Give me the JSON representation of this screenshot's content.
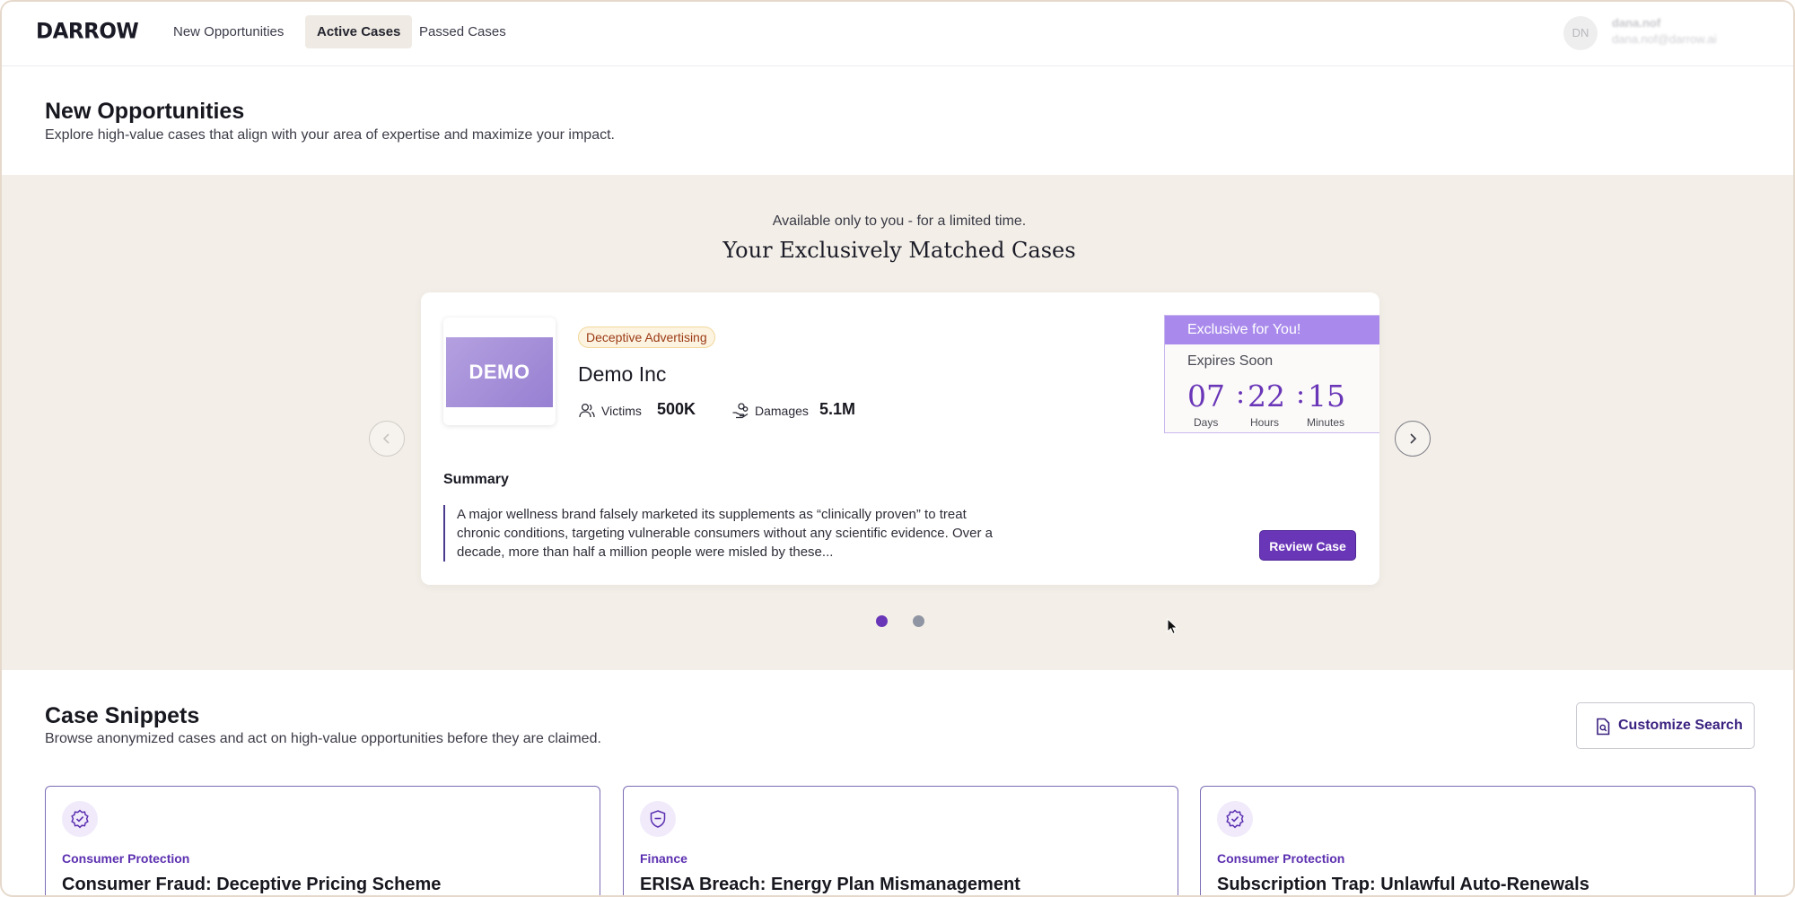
{
  "nav": {
    "logo": "DARROW",
    "items": [
      {
        "label": "New Opportunities",
        "active": false
      },
      {
        "label": "Active Cases",
        "active": true
      },
      {
        "label": "Passed Cases",
        "active": false
      }
    ],
    "user": {
      "initials": "DN",
      "name": "dana.nof",
      "email": "dana.nof@darrow.ai"
    }
  },
  "header": {
    "title": "New Opportunities",
    "subtitle": "Explore high-value cases that align with your area of expertise and maximize your impact."
  },
  "exclusive": {
    "kicker": "Available only to you - for a limited time.",
    "title": "Your Exclusively Matched Cases",
    "card": {
      "logo_text": "DEMO",
      "tag": "Deceptive Advertising",
      "company": "Demo Inc",
      "victims_label": "Victims",
      "victims_value": "500K",
      "damages_label": "Damages",
      "damages_value": "5.1M",
      "summary_label": "Summary",
      "summary_text": "A major wellness brand falsely marketed its supplements as “clinically proven” to treat chronic conditions, targeting vulnerable consumers without any scientific evidence. Over a decade, more than half a million people were misled by these...",
      "review_label": "Review Case",
      "badge": {
        "header": "Exclusive for You!",
        "sub": "Expires Soon",
        "days": "07",
        "hours": "22",
        "minutes": "15",
        "days_label": "Days",
        "hours_label": "Hours",
        "minutes_label": "Minutes"
      }
    },
    "pagination": {
      "count": 2,
      "active": 0
    },
    "colors": {
      "accent": "#6a36b8",
      "band_bg": "#f3efe8",
      "badge_header": "#a98aec"
    }
  },
  "snippets": {
    "title": "Case Snippets",
    "subtitle": "Browse anonymized cases and act on high-value opportunities before they are claimed.",
    "customize_label": "Customize Search",
    "cards": [
      {
        "category": "Consumer Protection",
        "title": "Consumer Fraud: Deceptive Pricing Scheme",
        "icon": "badge-check-icon"
      },
      {
        "category": "Finance",
        "title": "ERISA Breach: Energy Plan Mismanagement",
        "icon": "shield-icon"
      },
      {
        "category": "Consumer Protection",
        "title": "Subscription Trap: Unlawful Auto-Renewals",
        "icon": "badge-check-icon"
      }
    ]
  }
}
